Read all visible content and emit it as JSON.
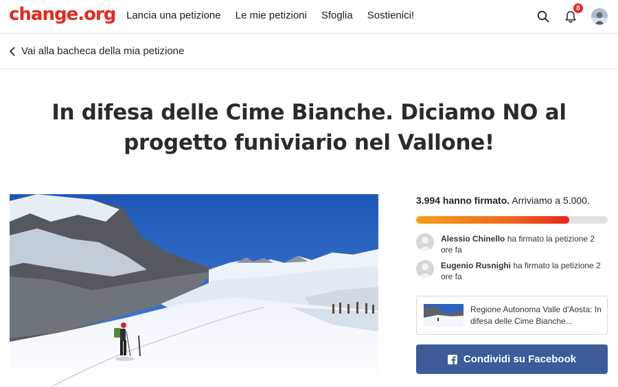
{
  "header": {
    "logo": "change.org",
    "nav": [
      "Lancia una petizione",
      "Le mie petizioni",
      "Sfoglia",
      "Sostienici!"
    ],
    "notification_count": "8",
    "icons": [
      "search-icon",
      "bell-icon",
      "user-avatar"
    ]
  },
  "back_link": {
    "label": "Vai alla bacheca della mia petizione",
    "icon": "chevron-left-icon"
  },
  "petition": {
    "title": "In difesa delle Cime Bianche. Diciamo NO al progetto funiviario nel Vallone!",
    "image_alt": "Scialpinista nel vallone innevato"
  },
  "sidebar": {
    "signed_count": "3.994 hanno firmato.",
    "goal_text": " Arriviamo a 5.000.",
    "progress_fraction": 0.8,
    "recent_signers": [
      {
        "name": "Alessio Chinello",
        "action": " ha firmato la petizione 2 ore fa"
      },
      {
        "name": "Eugenio Rusnighi",
        "action": " ha firmato la petizione 2 ore fa"
      }
    ],
    "decision_maker_card": "Regione Autonoma Valle d'Aosta: In difesa delle Cime Bianche...",
    "share_button": "Condividi su Facebook"
  },
  "colors": {
    "brand": "#e8271c",
    "facebook": "#3b5b99",
    "progress_start": "#f5a019",
    "progress_end": "#e4281c"
  }
}
